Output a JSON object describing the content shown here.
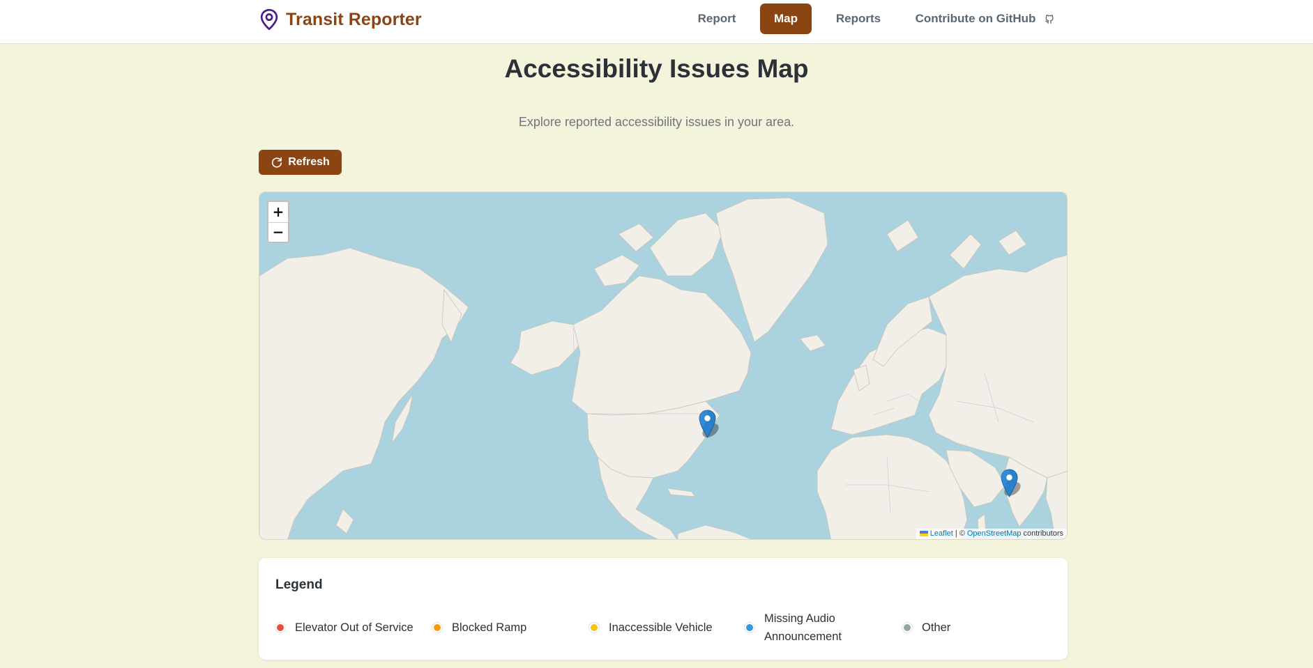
{
  "nav": {
    "brand": "Transit Reporter",
    "links": [
      {
        "label": "Report",
        "active": false
      },
      {
        "label": "Map",
        "active": true
      },
      {
        "label": "Reports",
        "active": false
      },
      {
        "label": "Contribute on GitHub",
        "active": false,
        "icon": "github-icon"
      }
    ]
  },
  "page": {
    "title": "Accessibility Issues Map",
    "subtitle": "Explore reported accessibility issues in your area."
  },
  "toolbar": {
    "refresh_label": "Refresh",
    "refresh_icon": "refresh-icon"
  },
  "map": {
    "zoom_in": "+",
    "zoom_out": "−",
    "attribution": {
      "leaflet": "Leaflet",
      "separator": "| ©",
      "osm": "OpenStreetMap",
      "suffix": "contributors"
    },
    "marker_color": "#2a81cb",
    "markers": [
      {
        "name": "marker-new-york"
      },
      {
        "name": "marker-india"
      }
    ]
  },
  "legend": {
    "title": "Legend",
    "items": [
      {
        "label": "Elevator Out of Service",
        "color": "#e74c3c"
      },
      {
        "label": "Blocked Ramp",
        "color": "#f39c12"
      },
      {
        "label": "Inaccessible Vehicle",
        "color": "#f1c40f"
      },
      {
        "label": "Missing Audio Announcement",
        "color": "#3498db"
      },
      {
        "label": "Other",
        "color": "#95a5a6"
      }
    ]
  },
  "colors": {
    "accent": "#8b4513",
    "background": "#f4f3dc",
    "water": "#aad3df",
    "land": "#f2efe9"
  }
}
